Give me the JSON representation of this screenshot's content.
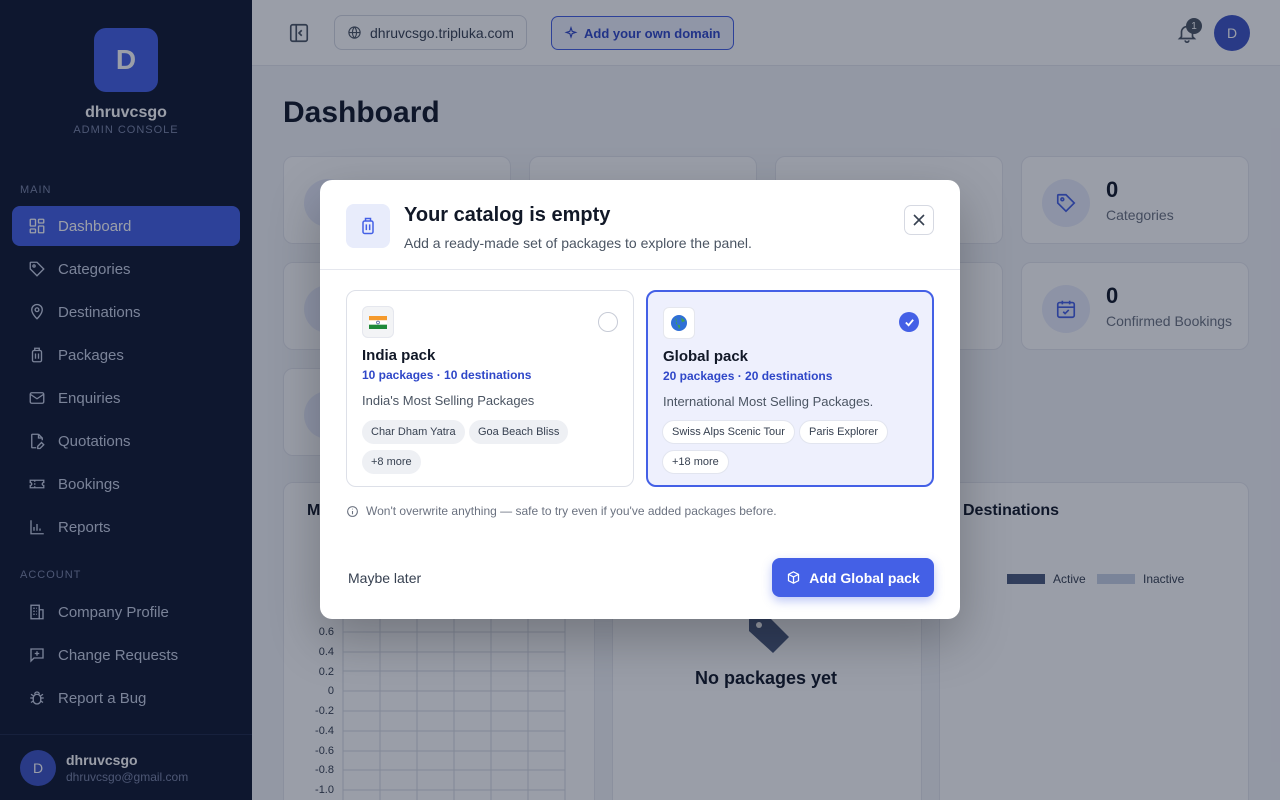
{
  "sidebar": {
    "brand_initial": "D",
    "brand_name": "dhruvcsgo",
    "brand_sub": "ADMIN CONSOLE",
    "main_label": "MAIN",
    "account_label": "ACCOUNT",
    "main_items": [
      {
        "label": "Dashboard",
        "icon": "grid-icon"
      },
      {
        "label": "Categories",
        "icon": "tag-icon"
      },
      {
        "label": "Destinations",
        "icon": "map-pin-icon"
      },
      {
        "label": "Packages",
        "icon": "luggage-icon"
      },
      {
        "label": "Enquiries",
        "icon": "mail-icon"
      },
      {
        "label": "Quotations",
        "icon": "document-edit-icon"
      },
      {
        "label": "Bookings",
        "icon": "ticket-icon"
      },
      {
        "label": "Reports",
        "icon": "bar-chart-icon"
      }
    ],
    "account_items": [
      {
        "label": "Company Profile",
        "icon": "building-icon"
      },
      {
        "label": "Change Requests",
        "icon": "message-plus-icon"
      },
      {
        "label": "Report a Bug",
        "icon": "bug-icon"
      }
    ],
    "user": {
      "initial": "D",
      "name": "dhruvcsgo",
      "email": "dhruvcsgo@gmail.com"
    }
  },
  "topbar": {
    "domain": "dhruvcsgo.tripluka.com",
    "add_domain_label": "Add your own domain",
    "notification_count": "1",
    "avatar_initial": "D"
  },
  "main": {
    "title": "Dashboard",
    "stats": [
      {
        "value": "0",
        "label": "Categories"
      },
      {
        "value": "0",
        "label": "Confirmed Bookings"
      }
    ],
    "panels": {
      "left_title_fragment": "M",
      "right_title": "Destinations",
      "legend_active": "Active",
      "legend_inactive": "Inactive",
      "empty_title": "No packages yet"
    },
    "y_ticks": [
      "0.6",
      "0.4",
      "0.2",
      "0",
      "-0.2",
      "-0.4",
      "-0.6",
      "-0.8",
      "-1.0"
    ]
  },
  "modal": {
    "title": "Your catalog is empty",
    "subtitle": "Add a ready-made set of packages to explore the panel.",
    "packs": [
      {
        "name": "India pack",
        "meta": "10 packages · 10 destinations",
        "description": "India's Most Selling Packages",
        "chips": [
          "Char Dham Yatra",
          "Goa Beach Bliss",
          "+8 more"
        ],
        "selected": false
      },
      {
        "name": "Global pack",
        "meta": "20 packages · 20 destinations",
        "description": "International Most Selling Packages.",
        "chips": [
          "Swiss Alps Scenic Tour",
          "Paris Explorer",
          "+18 more"
        ],
        "selected": true
      }
    ],
    "note": "Won't overwrite anything — safe to try even if you've added packages before.",
    "later_label": "Maybe later",
    "primary_label": "Add Global pack"
  },
  "colors": {
    "accent": "#4460e6",
    "sidebar_bg": "#0f1730"
  }
}
